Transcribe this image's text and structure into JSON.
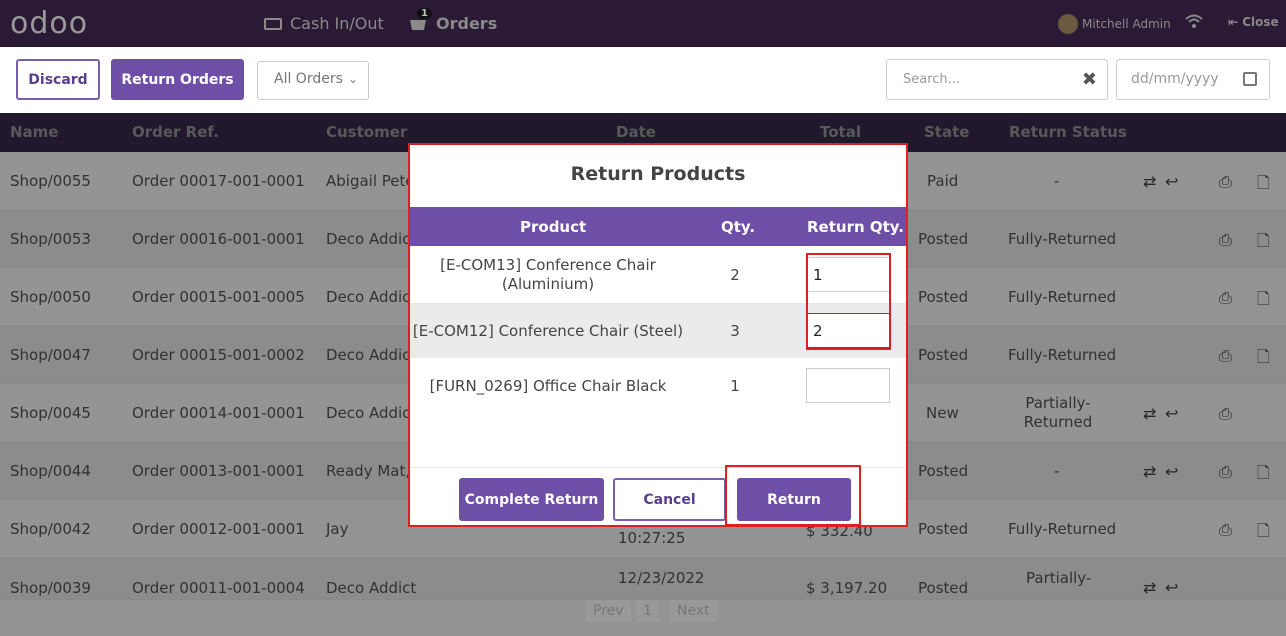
{
  "topbar": {
    "logo": "odoo",
    "cash_label": "Cash In/Out",
    "orders_label": "Orders",
    "orders_badge": "1",
    "user_name": "Mitchell Admin",
    "close_label": "Close"
  },
  "controls": {
    "discard_label": "Discard",
    "return_orders_label": "Return Orders",
    "filter_selected": "All Orders",
    "search_placeholder": "Search...",
    "date_placeholder": "dd/mm/yyyy"
  },
  "table": {
    "headers": [
      "Name",
      "Order Ref.",
      "Customer",
      "Date",
      "Total",
      "State",
      "Return Status"
    ],
    "rows": [
      {
        "name": "Shop/0055",
        "ref": "Order 00017-001-0001",
        "customer": "Abigail Pete",
        "date": "",
        "total": "",
        "state": "Paid",
        "return_status": "-"
      },
      {
        "name": "Shop/0053",
        "ref": "Order 00016-001-0001",
        "customer": "Deco Addic",
        "date": "",
        "total": "",
        "state": "Posted",
        "return_status": "Fully-Returned"
      },
      {
        "name": "Shop/0050",
        "ref": "Order 00015-001-0005",
        "customer": "Deco Addic",
        "date": "",
        "total": "",
        "state": "Posted",
        "return_status": "Fully-Returned"
      },
      {
        "name": "Shop/0047",
        "ref": "Order 00015-001-0002",
        "customer": "Deco Addic",
        "date": "",
        "total": "",
        "state": "Posted",
        "return_status": "Fully-Returned"
      },
      {
        "name": "Shop/0045",
        "ref": "Order 00014-001-0001",
        "customer": "Deco Addic",
        "date": "",
        "total": "",
        "state": "New",
        "return_status": "Partially-Returned"
      },
      {
        "name": "Shop/0044",
        "ref": "Order 00013-001-0001",
        "customer": "Ready Mat,",
        "date": "",
        "total": "",
        "state": "Posted",
        "return_status": "-"
      },
      {
        "name": "Shop/0042",
        "ref": "Order 00012-001-0001",
        "customer": "Jay",
        "date": "10:27:25",
        "total": "$ 332.40",
        "state": "Posted",
        "return_status": "Fully-Returned"
      },
      {
        "name": "Shop/0039",
        "ref": "Order 00011-001-0004",
        "customer": "Deco Addict",
        "date": "12/23/2022",
        "total": "$ 3,197.20",
        "state": "Posted",
        "return_status": "Partially-"
      }
    ]
  },
  "pager": {
    "prev": "Prev",
    "page": "1",
    "next": "Next"
  },
  "modal": {
    "title": "Return Products",
    "headers": {
      "product": "Product",
      "qty": "Qty.",
      "return_qty": "Return Qty."
    },
    "items": [
      {
        "product": "[E-COM13] Conference Chair (Aluminium)",
        "qty": "2",
        "return_qty": "1"
      },
      {
        "product": "[E-COM12] Conference Chair (Steel)",
        "qty": "3",
        "return_qty": "2"
      },
      {
        "product": "[FURN_0269] Office Chair Black",
        "qty": "1",
        "return_qty": ""
      }
    ],
    "complete_return_label": "Complete Return",
    "cancel_label": "Cancel",
    "return_label": "Return"
  }
}
